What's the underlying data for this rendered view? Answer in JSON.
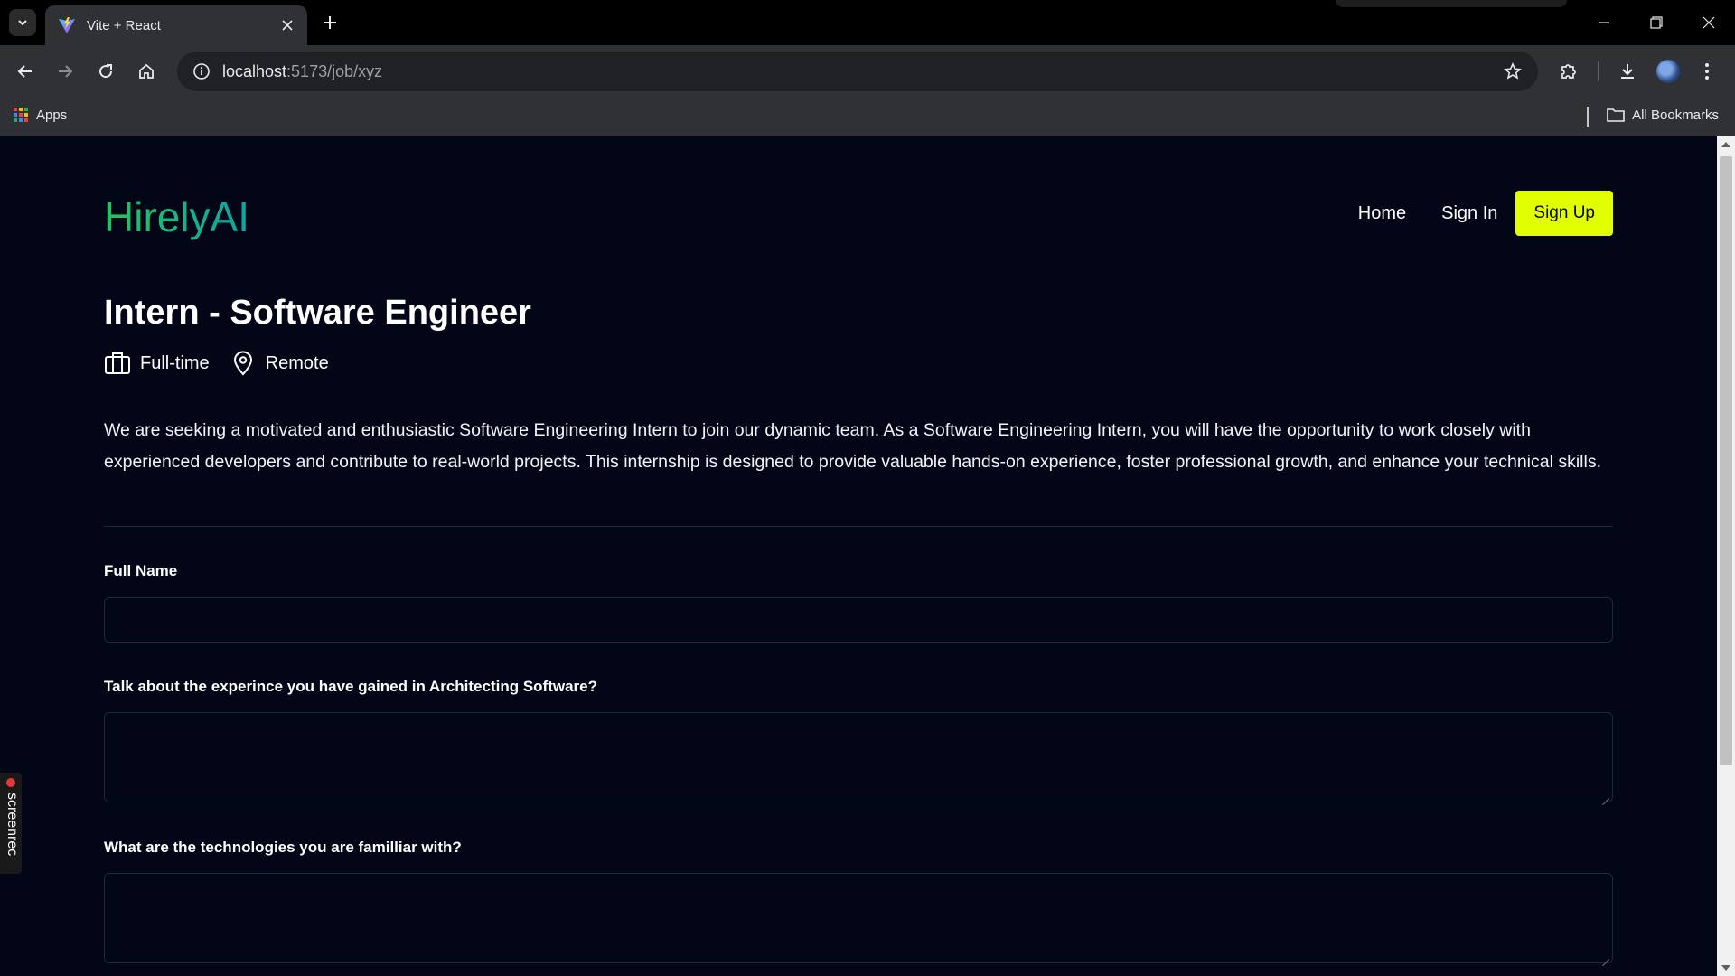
{
  "browser": {
    "tab_title": "Vite + React",
    "url_host": "localhost",
    "url_rest": ":5173/job/xyz",
    "bookmarks_apps_label": "Apps",
    "all_bookmarks_label": "All Bookmarks"
  },
  "site": {
    "logo": "HirelyAI",
    "nav": {
      "home": "Home",
      "sign_in": "Sign In",
      "sign_up": "Sign Up"
    },
    "colors": {
      "accent": "#e2ff00",
      "logo_gradient_start": "#22c55e",
      "logo_gradient_end": "#0ea5a4",
      "background": "#020617"
    }
  },
  "job": {
    "title": "Intern - Software Engineer",
    "employment_type": "Full-time",
    "location": "Remote",
    "description": "We are seeking a motivated and enthusiastic Software Engineering Intern to join our dynamic team. As a Software Engineering Intern, you will have the opportunity to work closely with experienced developers and contribute to real-world projects. This internship is designed to provide valuable hands-on experience, foster professional growth, and enhance your technical skills."
  },
  "form": {
    "full_name_label": "Full Name",
    "full_name_value": "",
    "q1_label": "Talk about the experince you have gained in Architecting Software?",
    "q1_value": "",
    "q2_label": "What are the technologies you are familliar with?",
    "q2_value": ""
  },
  "overlay": {
    "screenrec_label": "screenrec"
  }
}
